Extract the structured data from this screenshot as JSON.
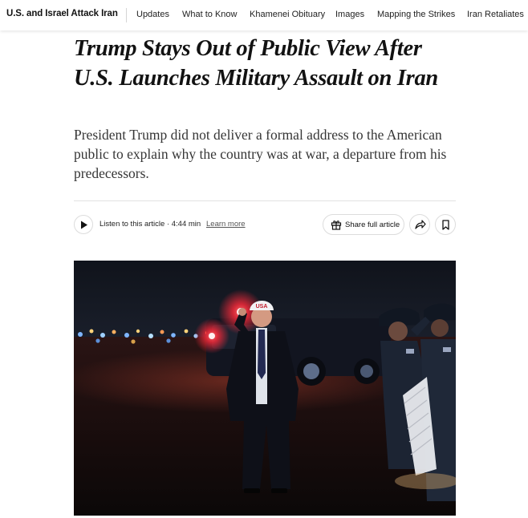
{
  "nav": {
    "section_title": "U.S. and Israel Attack Iran",
    "links": [
      "Updates",
      "What to Know",
      "Khamenei Obituary",
      "Images",
      "Mapping the Strikes",
      "Iran Retaliates"
    ]
  },
  "article": {
    "headline": "Trump Stays Out of Public View After U.S. Launches Military Assault on Iran",
    "summary": "President Trump did not deliver a formal address to the American public to explain why the country was at war, a departure from his predecessors."
  },
  "toolbar": {
    "listen_label": "Listen to this article · 4:44 min",
    "learn_more": "Learn more",
    "share_full_article": "Share full article",
    "icons": {
      "play": "play-icon",
      "gift": "gift-icon",
      "share": "share-arrow-icon",
      "save": "bookmark-icon"
    }
  },
  "photo": {
    "cap_text": "USA",
    "palette": {
      "night_sky": "#141821",
      "tarmac": "#1b0d0d",
      "red_glow": "#ff2a3a",
      "uniform": "#1c2433"
    }
  }
}
